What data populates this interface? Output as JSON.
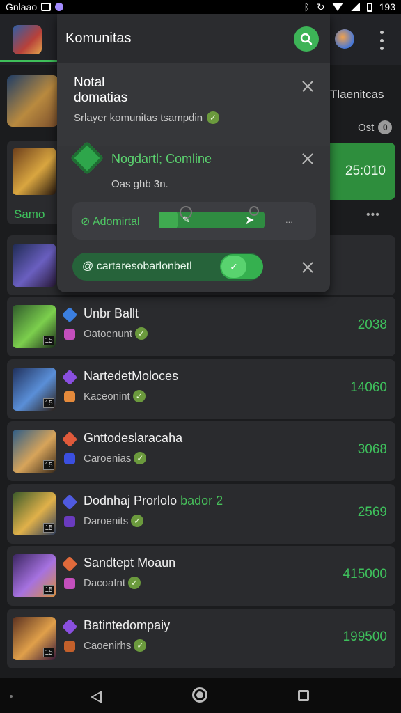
{
  "status_bar": {
    "carrier": "Gnlaao",
    "time": "193"
  },
  "header": {
    "title": "Komunitas"
  },
  "right_column": {
    "title": "Tlaenitcas",
    "filter_label": "Ost",
    "filter_badge": "0",
    "highlight_value": "25:010",
    "dots": "•••"
  },
  "left_peek": {
    "label": "Samo"
  },
  "panel": {
    "notification": {
      "title": "Notal\ndomatias",
      "subtitle": "Srlayer komunitas tsampdin"
    },
    "invite": {
      "title": "Nogdartl; Comline",
      "subtitle": "Oas ghb 3n."
    },
    "admin": {
      "label": "Adomirtal",
      "progress": 0.18,
      "ellipsis": "..."
    },
    "chip": {
      "label": "cartaresobarlonbetl"
    }
  },
  "list": [
    {
      "name": "Unbr Ballt",
      "tag": "",
      "sub": "Oatoenunt",
      "value": "2038",
      "level": "15",
      "colors": {
        "thumb_a": "#2f5a2b",
        "thumb_b": "#7ccf4d",
        "thumb_c": "#1a2a1a",
        "gem1": "#3b7fe0",
        "gem2": "#c44fbd"
      }
    },
    {
      "name": "NartedetMoloces",
      "tag": "",
      "sub": "Kaceonint",
      "value": "14060",
      "level": "15",
      "colors": {
        "thumb_a": "#1f2f5a",
        "thumb_b": "#5a8fd8",
        "thumb_c": "#2b1f16",
        "gem1": "#8a4fe0",
        "gem2": "#e58a3b"
      }
    },
    {
      "name": "Gnttodeslaracaha",
      "tag": "",
      "sub": "Caroenias",
      "value": "3068",
      "level": "15",
      "colors": {
        "thumb_a": "#2c5c88",
        "thumb_b": "#d7a45a",
        "thumb_c": "#3a2a1a",
        "gem1": "#e05a3b",
        "gem2": "#3b4fe0"
      }
    },
    {
      "name": "Dodnhaj Prorlolo",
      "tag": "bador 2",
      "sub": "Daroenits",
      "value": "2569",
      "level": "15",
      "colors": {
        "thumb_a": "#3a5a2a",
        "thumb_b": "#e0b14a",
        "thumb_c": "#2a3a5a",
        "gem1": "#4f5ae0",
        "gem2": "#6a3bbf"
      }
    },
    {
      "name": "Sandtept Moaun",
      "tag": "",
      "sub": "Dacoafnt",
      "value": "415000",
      "level": "15",
      "colors": {
        "thumb_a": "#3a2560",
        "thumb_b": "#a672e0",
        "thumb_c": "#d98e3b",
        "gem1": "#e06a3b",
        "gem2": "#c44fbd"
      }
    },
    {
      "name": "Batintedompaiy",
      "tag": "",
      "sub": "Caoenirhs",
      "value": "199500",
      "level": "15",
      "colors": {
        "thumb_a": "#5a3020",
        "thumb_b": "#e0a04a",
        "thumb_c": "#3a1a3a",
        "gem1": "#8a4fe0",
        "gem2": "#c4602b"
      }
    }
  ]
}
